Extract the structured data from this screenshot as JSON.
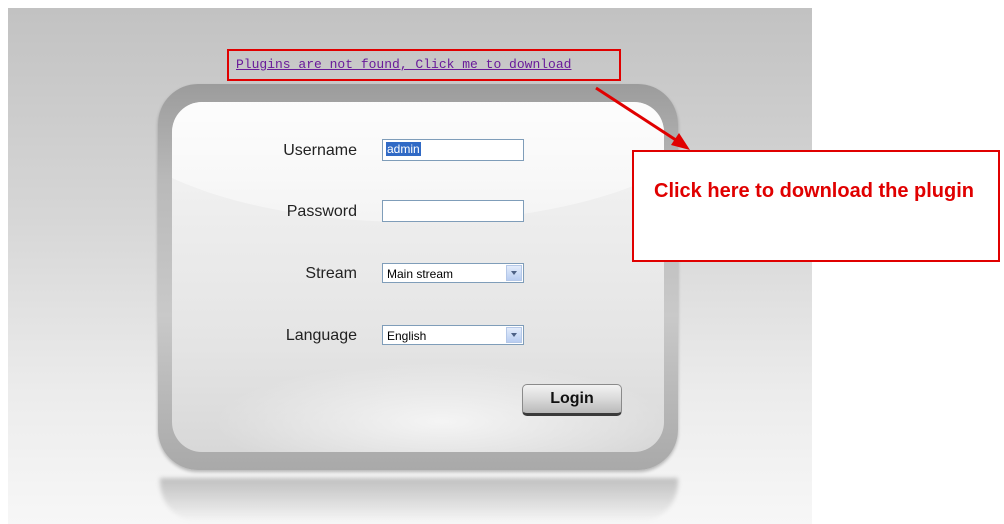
{
  "plugin": {
    "link_text": "Plugins are not found, Click me to download"
  },
  "login_form": {
    "username_label": "Username",
    "username_value": "admin",
    "password_label": "Password",
    "password_value": "",
    "stream_label": "Stream",
    "stream_selected": "Main stream",
    "language_label": "Language",
    "language_selected": "English",
    "login_button": "Login"
  },
  "annotation": {
    "callout_text": "Click here to download the plugin",
    "color": "#e00000"
  },
  "colors": {
    "link": "#6a1b9a",
    "selection": "#316ac5"
  }
}
